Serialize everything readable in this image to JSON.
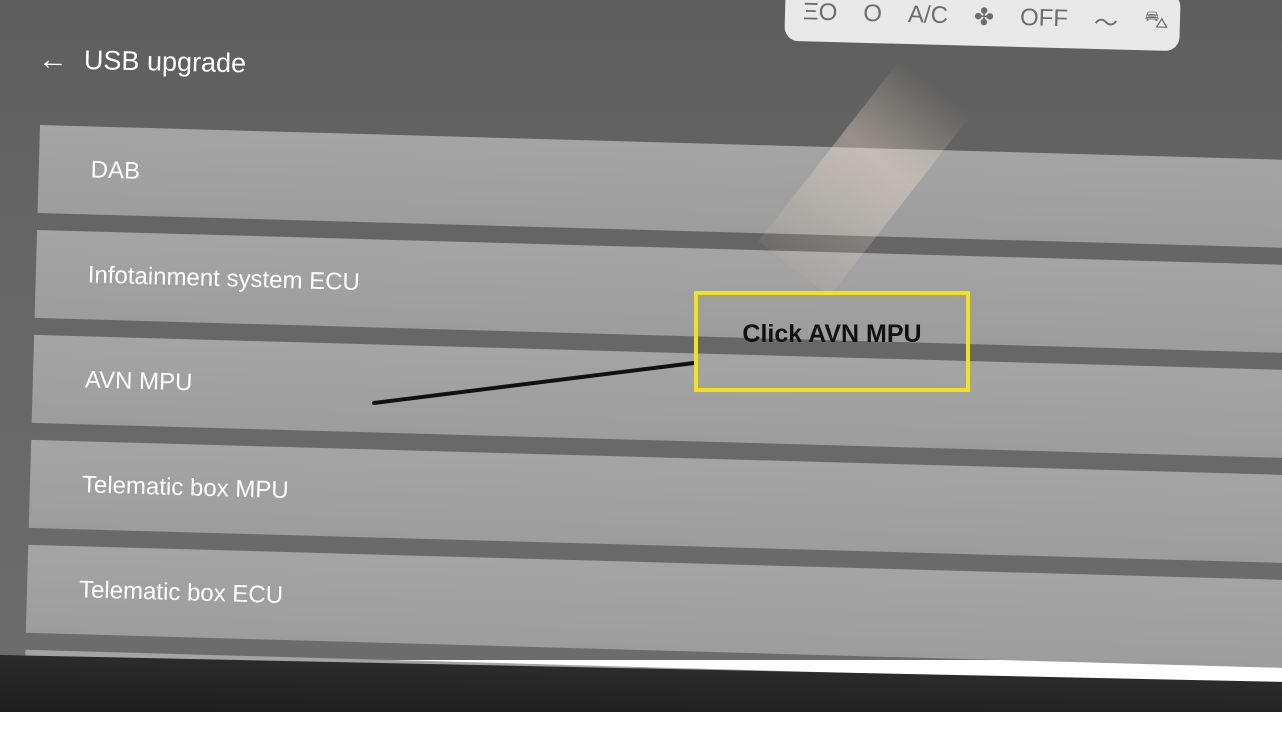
{
  "status_bar": {
    "items": [
      "ΞΟ",
      "Ο",
      "A/C",
      "OFF"
    ],
    "fan_icon": "fan-icon",
    "extra_icons": [
      "signal-icon",
      "car-icon"
    ]
  },
  "header": {
    "back_icon": "←",
    "title": "USB upgrade"
  },
  "list": {
    "items": [
      {
        "label": "DAB"
      },
      {
        "label": "Infotainment system ECU"
      },
      {
        "label": "AVN MPU"
      },
      {
        "label": "Telematic box MPU"
      },
      {
        "label": "Telematic box ECU"
      },
      {
        "label": ""
      }
    ]
  },
  "annotation": {
    "text": "Click AVN MPU",
    "border_color": "#f2e21c"
  }
}
